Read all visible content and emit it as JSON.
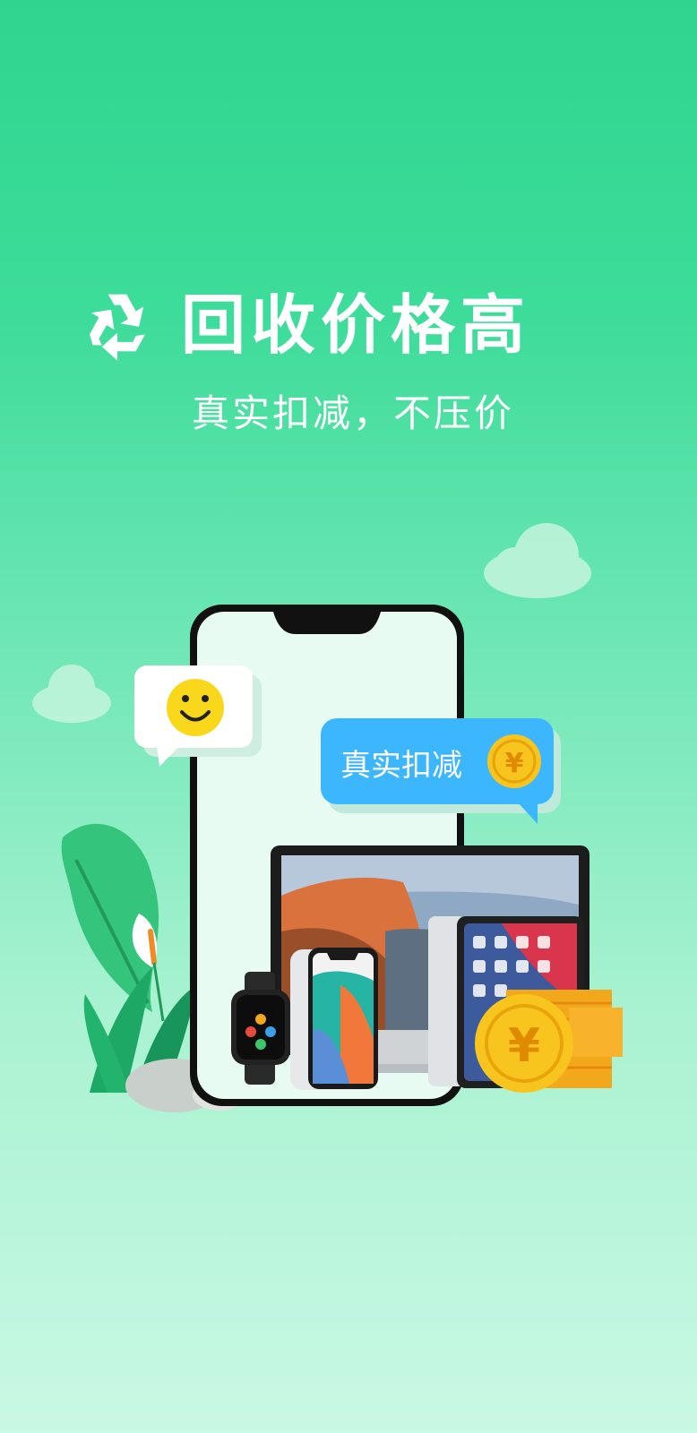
{
  "promo": {
    "title": "回收价格高",
    "subtitle": "真实扣减，不压价",
    "bubble_label": "真实扣减",
    "coin_symbol": "¥",
    "recycle_icon": "recycle-icon",
    "smiley_icon": "smiley-face-icon"
  },
  "colors": {
    "bg_top": "#2fd58f",
    "bg_bottom": "#c9f8e4",
    "bubble_blue": "#3cb7ff",
    "coin_gold": "#f7c51e",
    "phone_screen": "#e8fbf3",
    "leaf_green": "#2fbf72"
  }
}
